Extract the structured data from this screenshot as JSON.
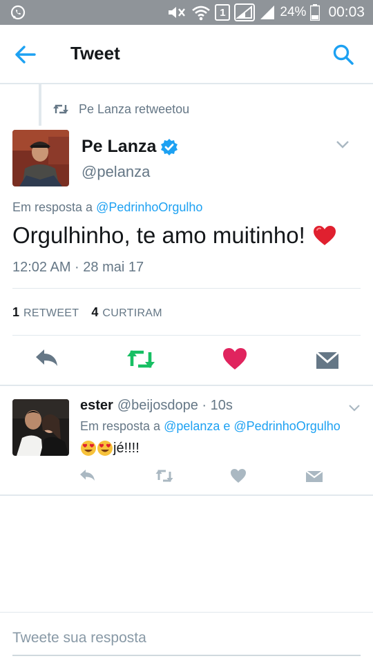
{
  "status_bar": {
    "battery": "24%",
    "sim": "1",
    "time": "00:03"
  },
  "appbar": {
    "title": "Tweet"
  },
  "tweet": {
    "retweet_context": "Pe Lanza retweetou",
    "author_name": "Pe Lanza",
    "author_handle": "@pelanza",
    "reply_prefix": "Em resposta a ",
    "reply_mention": "@PedrinhoOrgulho",
    "text": "Orgulhinho, te amo muitinho!",
    "timestamp": "12:02 AM · 28 mai 17",
    "retweets_count": "1",
    "retweets_label": "RETWEET",
    "likes_count": "4",
    "likes_label": "CURTIRAM"
  },
  "reply": {
    "author_name": "ester",
    "author_meta": "@beijosdope · 10s",
    "reply_prefix": "Em resposta a ",
    "reply_mention_1": "@pelanza",
    "reply_joiner": " e ",
    "reply_mention_2": "@PedrinhoOrgulho",
    "text": "jé!!!!"
  },
  "compose": {
    "placeholder": "Tweete sua resposta"
  },
  "colors": {
    "accent": "#1da1f2",
    "retweet_green": "#17bf63",
    "like_red": "#e0245e",
    "status_bar": "#8f9499"
  },
  "icons": [
    "whatsapp-icon",
    "back-arrow-icon",
    "search-icon",
    "retweet-icon",
    "verified-icon",
    "chevron-down-icon",
    "reply-icon",
    "like-icon",
    "message-icon",
    "heart-emoji",
    "heart-eyes-emoji"
  ]
}
